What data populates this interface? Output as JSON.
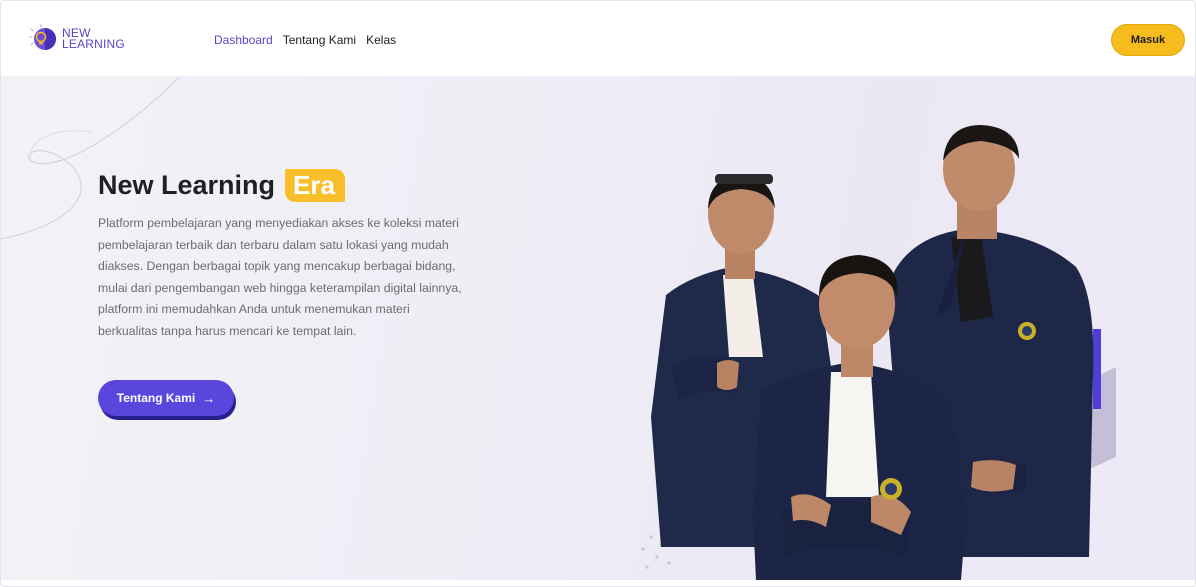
{
  "brand": {
    "line1": "NEW",
    "line2": "LEARNING"
  },
  "nav": {
    "items": [
      {
        "label": "Dashboard",
        "active": true
      },
      {
        "label": "Tentang Kami",
        "active": false
      },
      {
        "label": "Kelas",
        "active": false
      }
    ],
    "login_label": "Masuk"
  },
  "hero": {
    "title_main": "New Learning",
    "title_highlight": "Era",
    "description": "Platform pembelajaran yang menyediakan akses ke koleksi materi pembelajaran terbaik dan terbaru dalam satu lokasi yang mudah diakses. Dengan berbagai topik yang mencakup berbagai bidang, mulai dari pengembangan web hingga keterampilan digital lainnya, platform ini memudahkan Anda untuk menemukan materi berkualitas tanpa harus mencari ke tempat lain.",
    "cta_label": "Tentang Kami",
    "cta_icon": "arrow-right-icon"
  },
  "colors": {
    "accent": "#5a46dd",
    "brand": "#5b43c9",
    "highlight": "#f8bf2a",
    "login_button": "#f6bb1c"
  }
}
